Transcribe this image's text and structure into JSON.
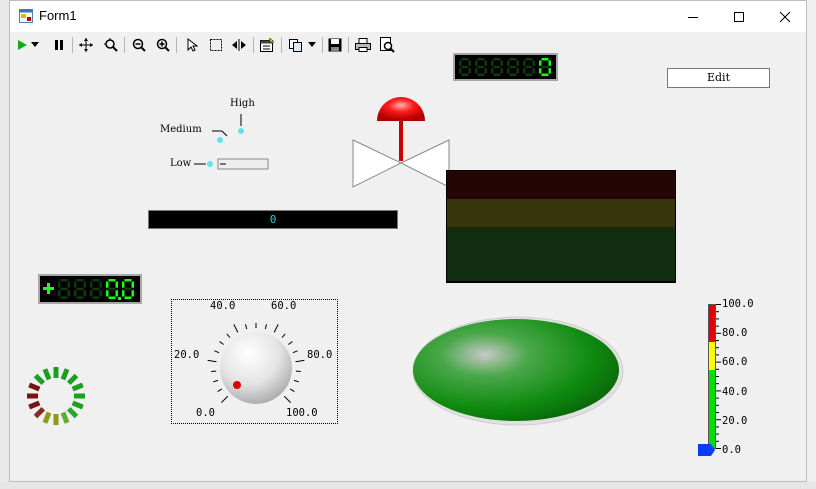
{
  "window": {
    "title": "Form1",
    "minimize_glyph": "minimize-icon",
    "maximize_glyph": "maximize-icon",
    "close_glyph": "close-icon"
  },
  "toolbar": {
    "buttons": [
      {
        "name": "play-icon"
      },
      {
        "name": "chevron-down-icon"
      },
      {
        "name": "pause-icon"
      },
      {
        "name": "move-icon"
      },
      {
        "name": "zoom-box-icon"
      },
      {
        "name": "zoom-out-icon"
      },
      {
        "name": "zoom-in-icon"
      },
      {
        "name": "pointer-icon"
      },
      {
        "name": "select-box-icon"
      },
      {
        "name": "split-icon"
      },
      {
        "name": "properties-icon"
      },
      {
        "name": "copy-icon"
      },
      {
        "name": "chevron-down-icon"
      },
      {
        "name": "save-icon"
      },
      {
        "name": "print-icon"
      },
      {
        "name": "print-preview-icon"
      }
    ]
  },
  "controls": {
    "edit_label": "Edit",
    "selector_labels": {
      "high": "High",
      "medium": "Medium",
      "low": "Low"
    },
    "progress_value": "0",
    "knob": {
      "labels": [
        "0.0",
        "20.0",
        "40.0",
        "60.0",
        "80.0",
        "100.0"
      ],
      "value": 0.0
    },
    "thermometer": {
      "labels": [
        "100.0",
        "80.0",
        "60.0",
        "40.0",
        "20.0",
        "0.0"
      ],
      "value": 0.0
    }
  },
  "colors": {
    "lcd_on": "#19ff19",
    "lcd_off": "#0f3a0f",
    "lamp_green": "#1a8a1a",
    "progress_text": "#3ec6e0",
    "valve_red": "#e00000"
  }
}
